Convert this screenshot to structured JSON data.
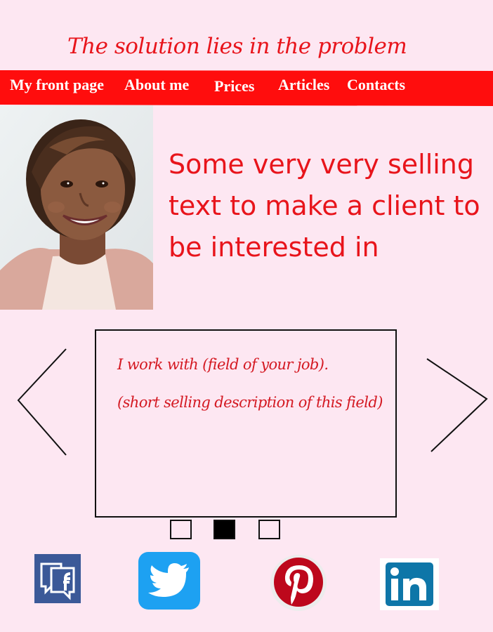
{
  "header": {
    "tagline": "The solution lies in the problem"
  },
  "nav": {
    "items": [
      {
        "label": "My front page"
      },
      {
        "label": "About me"
      },
      {
        "label": "Prices"
      },
      {
        "label": "Articles"
      },
      {
        "label": "Contacts"
      }
    ]
  },
  "hero": {
    "headline": "Some very very selling text to make a client to be interested in"
  },
  "carousel": {
    "slide_text_1": "I work with (field of your job).",
    "slide_text_2": "(short selling description of this field)",
    "dots": 3,
    "active_dot": 2,
    "prev_icon": "chevron-left-icon",
    "next_icon": "chevron-right-icon"
  },
  "social": {
    "items": [
      {
        "icon": "facebook-icon",
        "color": "#3b5998"
      },
      {
        "icon": "twitter-icon",
        "color": "#1da1f2"
      },
      {
        "icon": "pinterest-icon",
        "color": "#bd081c"
      },
      {
        "icon": "linkedin-icon",
        "color": "#0e76a8"
      }
    ]
  },
  "colors": {
    "accent": "#ff0d0d",
    "background": "#fde7f2",
    "text_red": "#e8141b"
  }
}
